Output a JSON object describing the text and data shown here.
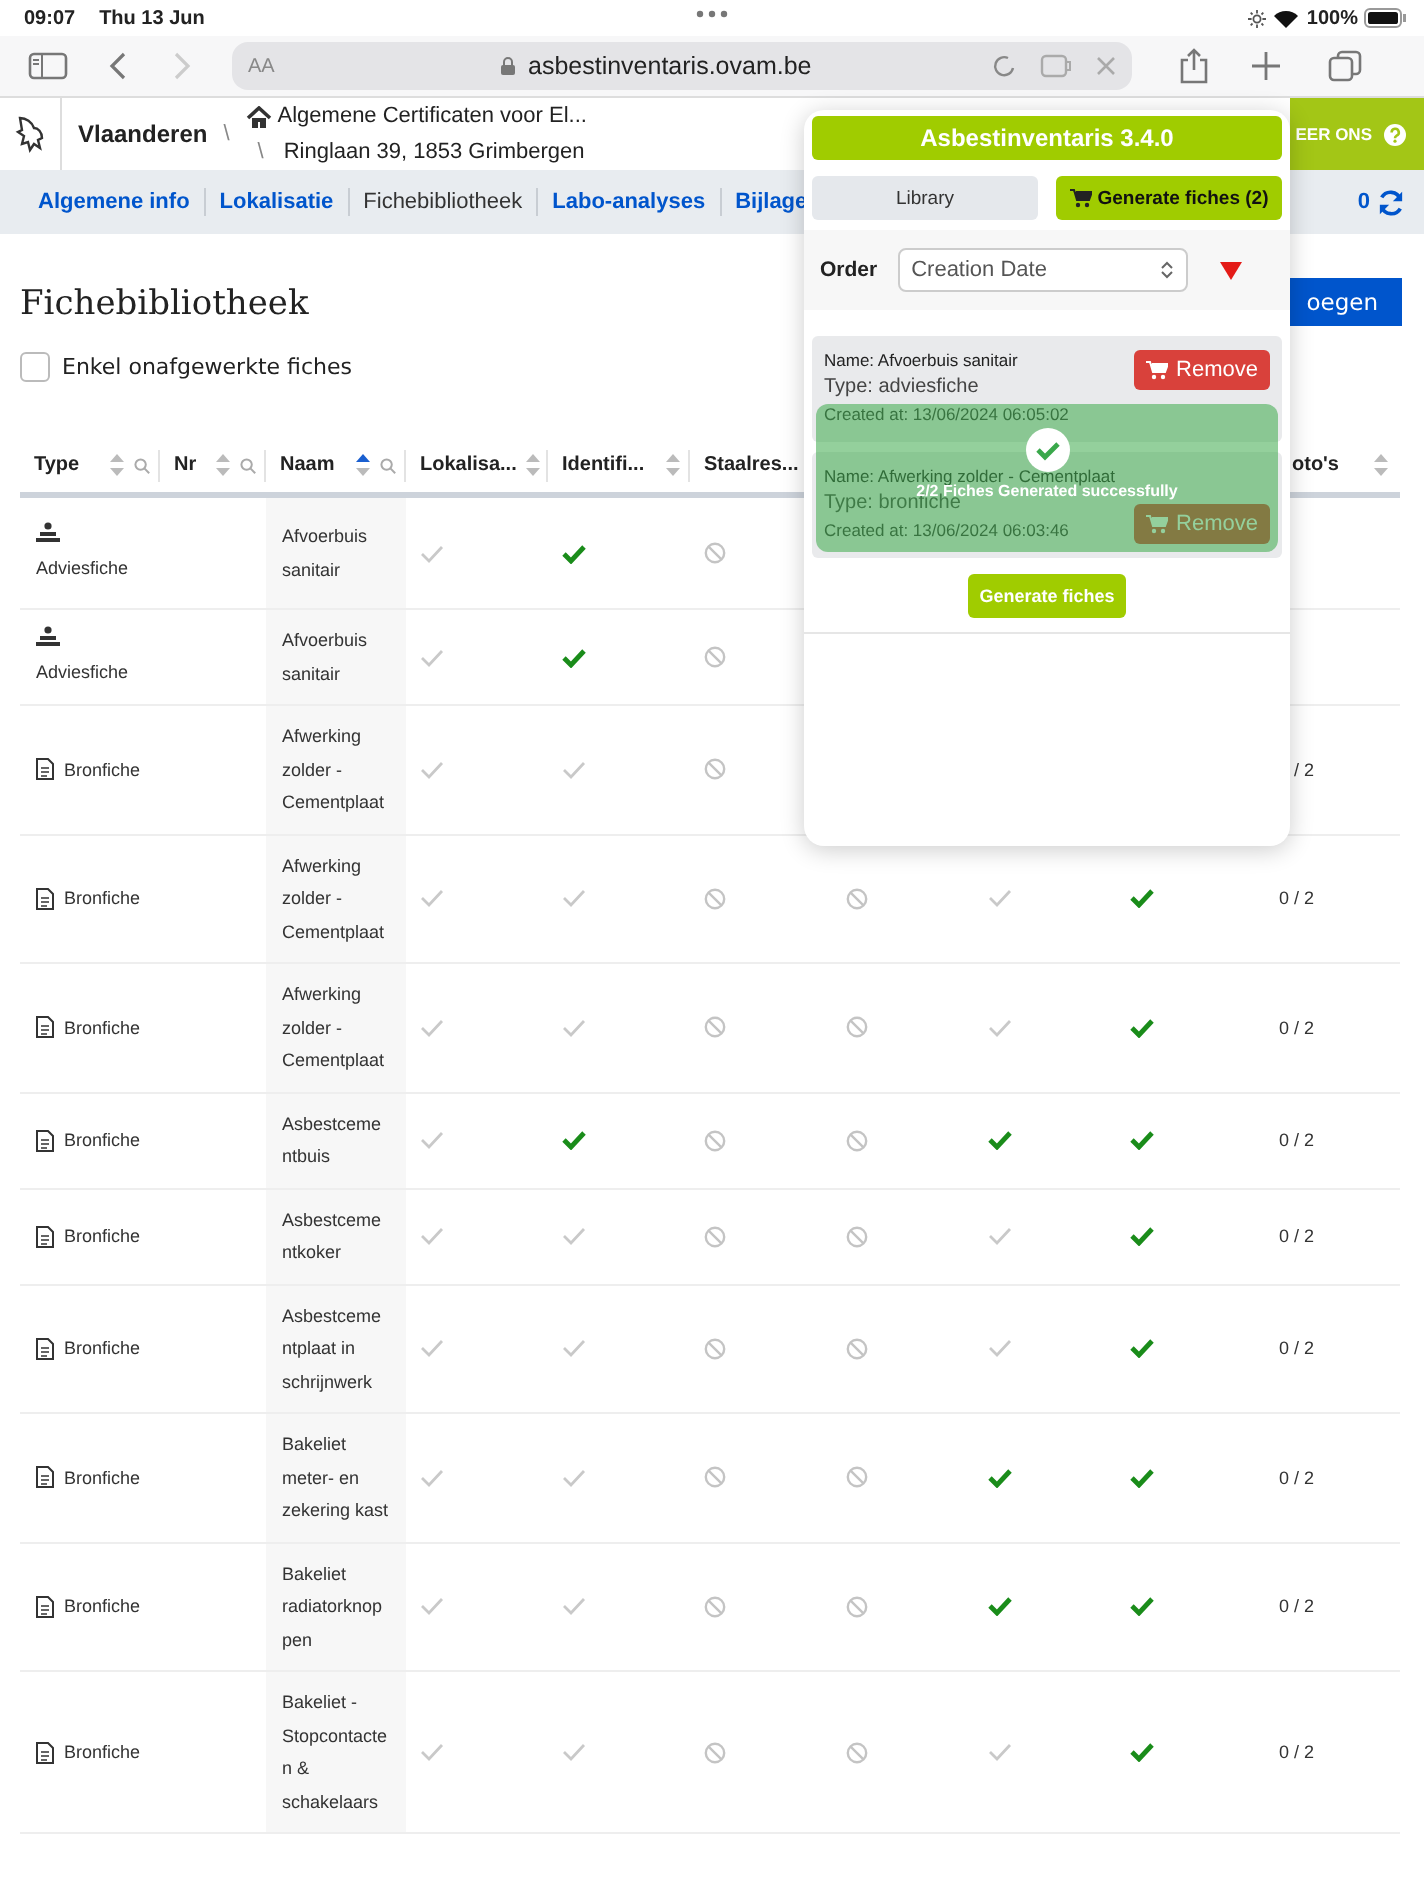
{
  "status_bar": {
    "time": "09:07",
    "date": "Thu 13 Jun",
    "battery": "100%"
  },
  "browser": {
    "text_size": "AA",
    "url": "asbestinventaris.ovam.be"
  },
  "site_header": {
    "brand": "Vlaanderen",
    "separator": "\\",
    "breadcrumb": "Algemene Certificaten voor El...",
    "address_separator": "\\",
    "address": "Ringlaan 39, 1853 Grimbergen",
    "contact": "EER ONS"
  },
  "nav": {
    "tabs": [
      {
        "label": "Algemene info",
        "selected": false
      },
      {
        "label": "Lokalisatie",
        "selected": false
      },
      {
        "label": "Fichebibliotheek",
        "selected": true
      },
      {
        "label": "Labo-analyses",
        "selected": false
      },
      {
        "label": "Bijlage",
        "selected": false
      }
    ],
    "count": "0"
  },
  "page": {
    "title": "Fichebibliotheek",
    "add_button": "oegen",
    "filter": {
      "label": "Enkel onafgewerkte fiches",
      "checked": false
    }
  },
  "table": {
    "columns": [
      {
        "label": "Type",
        "sortable": true,
        "sorted": false,
        "search": true
      },
      {
        "label": "Nr",
        "sortable": true,
        "sorted": false,
        "search": true
      },
      {
        "label": "Naam",
        "sortable": true,
        "sorted": true,
        "search": true
      },
      {
        "label": "Lokalisa...",
        "sortable": true,
        "sorted": false,
        "search": false
      },
      {
        "label": "Identifi...",
        "sortable": true,
        "sorted": false,
        "search": false
      },
      {
        "label": "Staalres...",
        "sortable": false,
        "search": false
      },
      null,
      null,
      null,
      {
        "label": "oto's",
        "sortable": true,
        "sorted": false,
        "search": false
      }
    ],
    "rows": [
      {
        "kind": "advies",
        "type": "Adviesfiche",
        "name": "Afvoerbuis sanitair",
        "cells": [
          {
            "kind": "check",
            "done": false
          },
          {
            "kind": "check",
            "done": true
          },
          {
            "kind": "na"
          },
          null,
          null,
          null
        ],
        "photos": null
      },
      {
        "kind": "advies",
        "type": "Adviesfiche",
        "name": "Afvoerbuis sanitair",
        "cells": [
          {
            "kind": "check",
            "done": false
          },
          {
            "kind": "check",
            "done": true
          },
          {
            "kind": "na"
          },
          null,
          null,
          null
        ],
        "photos": null
      },
      {
        "kind": "bron",
        "type": "Bronfiche",
        "name": "Afwerking zolder - Cementplaat",
        "cells": [
          {
            "kind": "check",
            "done": false
          },
          {
            "kind": "check",
            "done": false
          },
          {
            "kind": "na"
          },
          null,
          null,
          null
        ],
        "photos": "/ 2"
      },
      {
        "kind": "bron",
        "type": "Bronfiche",
        "name": "Afwerking zolder - Cementplaat",
        "cells": [
          {
            "kind": "check",
            "done": false
          },
          {
            "kind": "check",
            "done": false
          },
          {
            "kind": "na"
          },
          {
            "kind": "na"
          },
          {
            "kind": "check",
            "done": false
          },
          {
            "kind": "check",
            "done": true
          }
        ],
        "photos": "0 / 2"
      },
      {
        "kind": "bron",
        "type": "Bronfiche",
        "name": "Afwerking zolder - Cementplaat",
        "cells": [
          {
            "kind": "check",
            "done": false
          },
          {
            "kind": "check",
            "done": false
          },
          {
            "kind": "na"
          },
          {
            "kind": "na"
          },
          {
            "kind": "check",
            "done": false
          },
          {
            "kind": "check",
            "done": true
          }
        ],
        "photos": "0 / 2"
      },
      {
        "kind": "bron",
        "type": "Bronfiche",
        "name": "Asbestcementbuis",
        "cells": [
          {
            "kind": "check",
            "done": false
          },
          {
            "kind": "check",
            "done": true
          },
          {
            "kind": "na"
          },
          {
            "kind": "na"
          },
          {
            "kind": "check",
            "done": true
          },
          {
            "kind": "check",
            "done": true
          }
        ],
        "photos": "0 / 2"
      },
      {
        "kind": "bron",
        "type": "Bronfiche",
        "name": "Asbestcementkoker",
        "cells": [
          {
            "kind": "check",
            "done": false
          },
          {
            "kind": "check",
            "done": false
          },
          {
            "kind": "na"
          },
          {
            "kind": "na"
          },
          {
            "kind": "check",
            "done": false
          },
          {
            "kind": "check",
            "done": true
          }
        ],
        "photos": "0 / 2"
      },
      {
        "kind": "bron",
        "type": "Bronfiche",
        "name": "Asbestcementplaat in schrijnwerk",
        "cells": [
          {
            "kind": "check",
            "done": false
          },
          {
            "kind": "check",
            "done": false
          },
          {
            "kind": "na"
          },
          {
            "kind": "na"
          },
          {
            "kind": "check",
            "done": false
          },
          {
            "kind": "check",
            "done": true
          }
        ],
        "photos": "0 / 2"
      },
      {
        "kind": "bron",
        "type": "Bronfiche",
        "name": "Bakeliet meter- en zekering kast",
        "cells": [
          {
            "kind": "check",
            "done": false
          },
          {
            "kind": "check",
            "done": false
          },
          {
            "kind": "na"
          },
          {
            "kind": "na"
          },
          {
            "kind": "check",
            "done": true
          },
          {
            "kind": "check",
            "done": true
          }
        ],
        "photos": "0 / 2"
      },
      {
        "kind": "bron",
        "type": "Bronfiche",
        "name": "Bakeliet radiatorknoppen",
        "cells": [
          {
            "kind": "check",
            "done": false
          },
          {
            "kind": "check",
            "done": false
          },
          {
            "kind": "na"
          },
          {
            "kind": "na"
          },
          {
            "kind": "check",
            "done": true
          },
          {
            "kind": "check",
            "done": true
          }
        ],
        "photos": "0 / 2"
      },
      {
        "kind": "bron",
        "type": "Bronfiche",
        "name": "Bakeliet - Stopcontacten & schakelaars",
        "cells": [
          {
            "kind": "check",
            "done": false
          },
          {
            "kind": "check",
            "done": false
          },
          {
            "kind": "na"
          },
          {
            "kind": "na"
          },
          {
            "kind": "check",
            "done": false
          },
          {
            "kind": "check",
            "done": true
          }
        ],
        "photos": "0 / 2"
      }
    ]
  },
  "popup": {
    "title": "Asbestinventaris 3.4.0",
    "tabs": [
      {
        "label": "Library",
        "selected": false,
        "kind": "plain"
      },
      {
        "label": "Generate fiches (2)",
        "selected": true,
        "kind": "cart"
      }
    ],
    "order_label": "Order",
    "order_value": "Creation Date",
    "descending": true,
    "items": [
      {
        "name": "Name: Afvoerbuis sanitair",
        "type": "Type: adviesfiche",
        "created": "Created at: 13/06/2024 06:05:02",
        "remove": "Remove"
      },
      {
        "name": "Name: Afwerking zolder - Cementplaat",
        "type": "Type: bronfiche",
        "created": "Created at: 13/06/2024 06:03:46",
        "remove": "Remove"
      }
    ],
    "toast": "2/2 Fiches Generated successfully",
    "generate": "Generate fiches"
  }
}
